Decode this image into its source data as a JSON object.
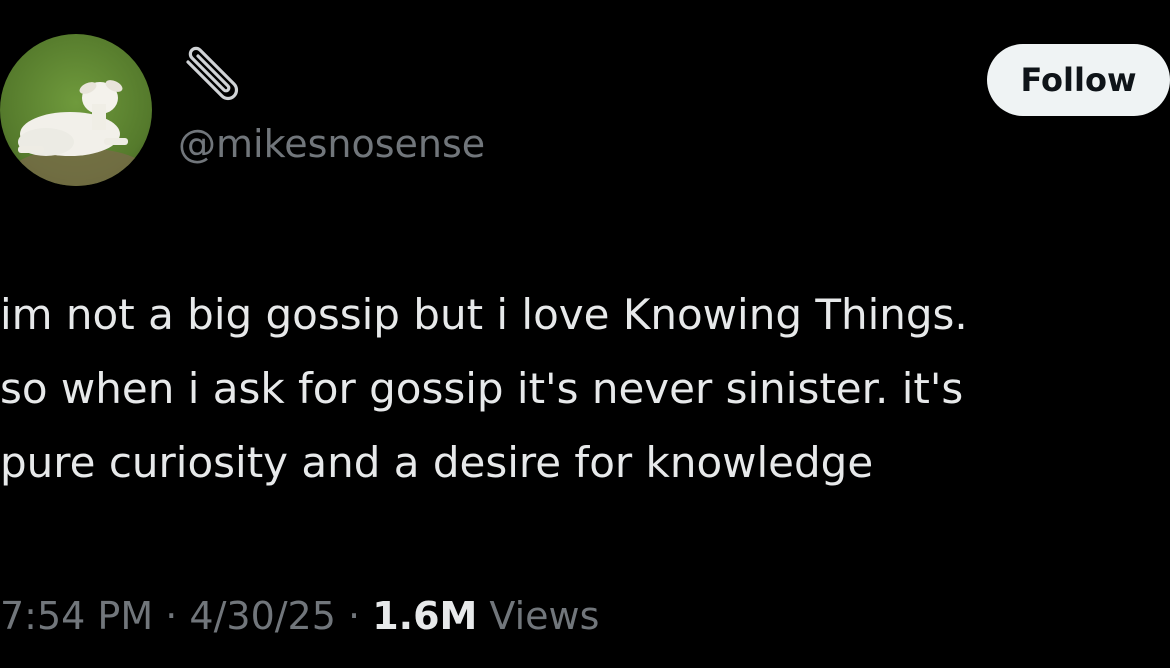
{
  "user": {
    "handle": "@mikesnosense",
    "avatar_icon": "lamb-avatar",
    "badge_icon": "paperclip-icon"
  },
  "follow_button": {
    "label": "Follow"
  },
  "tweet": {
    "lines": [
      "im not a big gossip but i love Knowing Things.",
      "so when i ask for gossip it's never sinister. it's",
      "pure curiosity and a desire for knowledge"
    ]
  },
  "meta": {
    "time": "7:54 PM",
    "separator": "·",
    "date": "4/30/25",
    "views_count": "1.6M",
    "views_label": "Views"
  },
  "colors": {
    "background": "#000000",
    "text_primary": "#e7e9ea",
    "text_secondary": "#71767b",
    "button_bg": "#eff3f4",
    "button_text": "#0f1419"
  }
}
